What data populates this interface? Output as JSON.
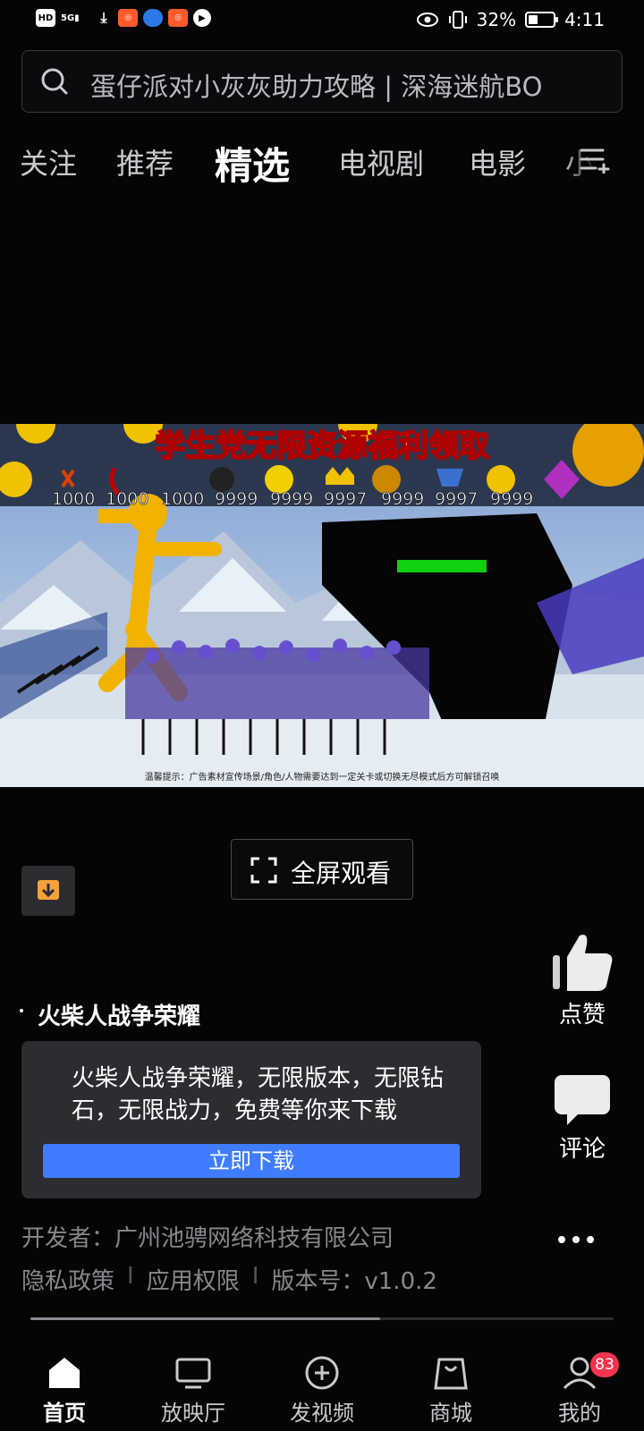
{
  "status_bar": {
    "left_icons": [
      "hd-icon",
      "signal-5g-icon",
      "download-icon",
      "app-icon",
      "browser-icon",
      "app-icon",
      "video-app-icon"
    ],
    "hd_label": "HD",
    "network_label": "5G",
    "battery_percent": "32%",
    "battery_level": 0.32,
    "time": "4:11"
  },
  "search": {
    "text": "蛋仔派对小灰灰助力攻略 | 深海迷航BO"
  },
  "tabs": [
    {
      "label": "关注",
      "active": false
    },
    {
      "label": "推荐",
      "active": false
    },
    {
      "label": "精选",
      "active": true
    },
    {
      "label": "电视剧",
      "active": false
    },
    {
      "label": "电影",
      "active": false
    },
    {
      "label": "小",
      "active": false
    }
  ],
  "video": {
    "banner": "学生党无限资源福利领取",
    "resource_counts": [
      "1000",
      "1000",
      "1000",
      "9999",
      "9999",
      "9997",
      "9999",
      "9997",
      "9999"
    ],
    "disclaimer": "温馨提示：广告素材宣传场景/角色/人物需要达到一定关卡或切换无尽模式后方可解锁召唤"
  },
  "fullscreen_label": "全屏观看",
  "ad": {
    "title": "火柴人战争荣耀",
    "description": "火柴人战争荣耀，无限版本，无限钻石，无限战力，免费等你来下载",
    "cta": "立即下载",
    "developer": "开发者：广州池骋网络科技有限公司",
    "privacy": "隐私政策",
    "permissions": "应用权限",
    "version": "版本号：v1.0.2",
    "separator": "I"
  },
  "actions": {
    "like": "点赞",
    "comment": "评论"
  },
  "progress": 0.6,
  "nav": [
    {
      "label": "首页",
      "icon": "home-icon",
      "active": true
    },
    {
      "label": "放映厅",
      "icon": "tv-icon",
      "active": false
    },
    {
      "label": "发视频",
      "icon": "add-circle-icon",
      "active": false
    },
    {
      "label": "商城",
      "icon": "shopping-bag-icon",
      "active": false
    },
    {
      "label": "我的",
      "icon": "profile-icon",
      "active": false
    }
  ],
  "notification_count": "83",
  "colors": {
    "accent": "#3f7cff",
    "badge": "#f5334f",
    "background": "#050506"
  }
}
